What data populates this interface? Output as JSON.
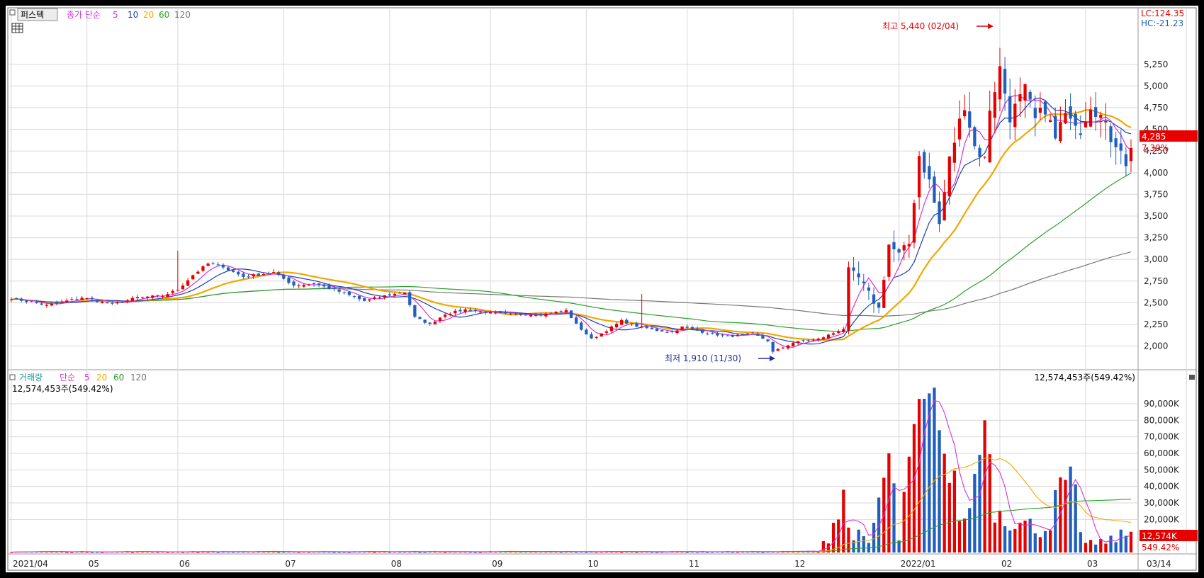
{
  "header": {
    "stock_name": "퍼스텍",
    "price_ma_label": "종가 단순",
    "ma_periods": [
      "5",
      "10",
      "20",
      "60",
      "120"
    ],
    "lc_label": "LC:124.35",
    "hc_label": "HC:-21.23"
  },
  "volume_header": {
    "title": "거래량",
    "ma_label": "단순",
    "ma_periods": [
      "5",
      "20",
      "60",
      "120"
    ],
    "summary_left": "12,574,453주(549.42%)",
    "summary_right": "12,574,453주(549.42%)"
  },
  "annotations": {
    "high": "최고 5,440 (02/04)",
    "low": "최저 1,910 (11/30)",
    "last_price": "4,285",
    "last_change": "7.39%",
    "last_volume": "12,574K",
    "last_volume_pct": "549.42%"
  },
  "colors": {
    "up": "#e60000",
    "down": "#1f5fbf",
    "ma5": "#d633d6",
    "ma10": "#1a3fb0",
    "ma20": "#f0a800",
    "ma60": "#2aa02a",
    "ma120": "#777777",
    "grid": "#d8d8d8"
  },
  "chart_data": [
    {
      "type": "candlestick",
      "title": "",
      "ylim": [
        1800,
        5600
      ],
      "y_ticks": [
        "2,000",
        "2,250",
        "2,500",
        "2,750",
        "3,000",
        "3,250",
        "3,500",
        "3,750",
        "4,000",
        "4,250",
        "4,500",
        "4,750",
        "5,000",
        "5,250"
      ],
      "y_tick_values": [
        2000,
        2250,
        2500,
        2750,
        3000,
        3250,
        3500,
        3750,
        4000,
        4250,
        4500,
        4750,
        5000,
        5250
      ],
      "x_labels": [
        "2021/04",
        "05",
        "06",
        "07",
        "08",
        "09",
        "10",
        "11",
        "12",
        "2022/01",
        "02",
        "03",
        "03/14"
      ],
      "x_label_index": [
        0,
        15,
        33,
        54,
        75,
        95,
        114,
        134,
        155,
        176,
        196,
        213,
        233
      ],
      "close_anchors": [
        [
          0,
          2550
        ],
        [
          7,
          2470
        ],
        [
          14,
          2560
        ],
        [
          20,
          2480
        ],
        [
          25,
          2560
        ],
        [
          30,
          2580
        ],
        [
          33,
          2650
        ],
        [
          36,
          2820
        ],
        [
          39,
          2950
        ],
        [
          42,
          2920
        ],
        [
          43,
          2880
        ],
        [
          46,
          2800
        ],
        [
          52,
          2850
        ],
        [
          56,
          2700
        ],
        [
          60,
          2720
        ],
        [
          64,
          2650
        ],
        [
          70,
          2520
        ],
        [
          74,
          2580
        ],
        [
          78,
          2620
        ],
        [
          80,
          2330
        ],
        [
          83,
          2250
        ],
        [
          86,
          2370
        ],
        [
          90,
          2420
        ],
        [
          95,
          2380
        ],
        [
          100,
          2360
        ],
        [
          106,
          2370
        ],
        [
          110,
          2410
        ],
        [
          112,
          2250
        ],
        [
          115,
          2080
        ],
        [
          118,
          2180
        ],
        [
          121,
          2290
        ],
        [
          124,
          2230
        ],
        [
          128,
          2180
        ],
        [
          131,
          2160
        ],
        [
          133,
          2220
        ],
        [
          138,
          2150
        ],
        [
          142,
          2110
        ],
        [
          147,
          2140
        ],
        [
          150,
          2060
        ],
        [
          151,
          1930
        ],
        [
          155,
          2040
        ],
        [
          160,
          2080
        ],
        [
          163,
          2150
        ],
        [
          165,
          2200
        ],
        [
          166,
          2860
        ],
        [
          168,
          2780
        ],
        [
          170,
          2600
        ],
        [
          172,
          2430
        ],
        [
          174,
          3170
        ],
        [
          176,
          3050
        ],
        [
          178,
          3180
        ],
        [
          180,
          4200
        ],
        [
          182,
          3900
        ],
        [
          184,
          3400
        ],
        [
          186,
          4150
        ],
        [
          189,
          4800
        ],
        [
          191,
          4300
        ],
        [
          193,
          4150
        ],
        [
          194,
          4750
        ],
        [
          196,
          5200
        ],
        [
          198,
          4650
        ],
        [
          201,
          4950
        ],
        [
          203,
          4600
        ],
        [
          205,
          4750
        ],
        [
          207,
          4380
        ],
        [
          208,
          4550
        ],
        [
          210,
          4700
        ],
        [
          212,
          4500
        ],
        [
          214,
          4800
        ],
        [
          216,
          4650
        ],
        [
          218,
          4400
        ],
        [
          220,
          4300
        ],
        [
          221,
          4050
        ],
        [
          222,
          4285
        ]
      ],
      "volume_anchors": [
        [
          0,
          600
        ],
        [
          150,
          600
        ],
        [
          160,
          900
        ],
        [
          165,
          38000
        ],
        [
          166,
          16000
        ],
        [
          170,
          5000
        ],
        [
          174,
          60000
        ],
        [
          176,
          9000
        ],
        [
          178,
          58000
        ],
        [
          181,
          93000
        ],
        [
          184,
          74000
        ],
        [
          186,
          48000
        ],
        [
          189,
          18000
        ],
        [
          193,
          80000
        ],
        [
          195,
          30000
        ],
        [
          200,
          18000
        ],
        [
          205,
          15000
        ],
        [
          210,
          52000
        ],
        [
          212,
          10000
        ],
        [
          215,
          5000
        ],
        [
          222,
          12574
        ]
      ],
      "volume_ylim": [
        0,
        96000
      ],
      "volume_ticks": [
        "20,000K",
        "30,000K",
        "40,000K",
        "50,000K",
        "60,000K",
        "70,000K",
        "80,000K",
        "90,000K"
      ],
      "volume_tick_values": [
        20000,
        30000,
        40000,
        50000,
        60000,
        70000,
        80000,
        90000
      ],
      "high": 5440,
      "low": 1910,
      "last_close": 4285,
      "last_volume_k": 12574
    }
  ]
}
